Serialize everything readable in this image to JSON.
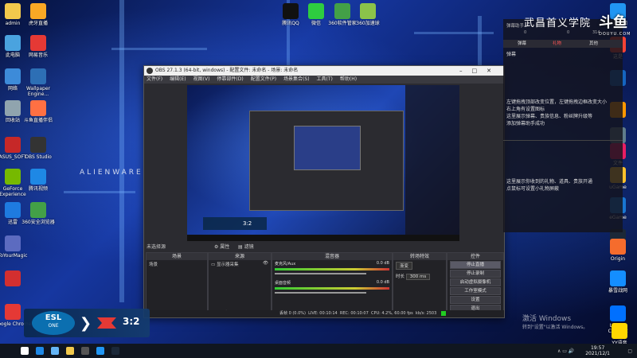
{
  "desktop": {
    "left_icons": [
      {
        "label": "admin",
        "color": "#f2c94c"
      },
      {
        "label": "虎牙直播",
        "color": "#f9a825"
      },
      {
        "label": "此电脑",
        "color": "#4aa3df"
      },
      {
        "label": "网易音乐",
        "color": "#e53935"
      },
      {
        "label": "网络",
        "color": "#3d8bd9"
      },
      {
        "label": "Wallpaper Engine...",
        "color": "#2d6fb5"
      },
      {
        "label": "回收站",
        "color": "#90a4ae"
      },
      {
        "label": "斗鱼直播伴侣",
        "color": "#ff7043"
      },
      {
        "label": "ASUS_SOFT",
        "color": "#c62828"
      },
      {
        "label": "OBS Studio",
        "color": "#333333"
      },
      {
        "label": "GeForce Experience",
        "color": "#76b900"
      },
      {
        "label": "腾讯视频",
        "color": "#1e88e5"
      },
      {
        "label": "迅雷",
        "color": "#1e7be0"
      },
      {
        "label": "360安全浏览器",
        "color": "#43a047"
      },
      {
        "label": "ToYourMagic",
        "color": "#5c6bc0"
      },
      {
        "label": "",
        "color": "#d32f2f"
      },
      {
        "label": "Google Chrome",
        "color": "#e53935"
      }
    ],
    "top_icons": [
      {
        "label": "腾讯QQ",
        "color": "#111111"
      },
      {
        "label": "微信",
        "color": "#2ecc40"
      },
      {
        "label": "360软件管家",
        "color": "#43a047"
      },
      {
        "label": "360加速球",
        "color": "#8bc34a"
      }
    ],
    "right_icons": [
      {
        "label": "这是桌面",
        "color": "#2196f3"
      },
      {
        "label": "这是",
        "color": "#f44336"
      },
      {
        "label": "",
        "color": "#1565c0"
      },
      {
        "label": "",
        "color": "#ff9800"
      },
      {
        "label": "",
        "color": "#607d8b"
      },
      {
        "label": "文件",
        "color": "#e91e63"
      },
      {
        "label": "uGame",
        "color": "#fbc02d"
      },
      {
        "label": "eGame",
        "color": "#1976d2"
      },
      {
        "label": "Steam",
        "color": "#1b2838"
      },
      {
        "label": "Origin",
        "color": "#f56c2d"
      },
      {
        "label": "暴雪战网",
        "color": "#148eff"
      },
      {
        "label": "Ubisoft Connect",
        "color": "#0070ff"
      },
      {
        "label": "YY语音",
        "color": "#ffd600"
      }
    ]
  },
  "brand_text": "ALIENWARE",
  "obs": {
    "title": "OBS 27.1.3 (64-bit, windows) - 配置文件: 未命名 - 场景: 未命名",
    "menu": [
      "文件(F)",
      "编辑(E)",
      "视图(V)",
      "停靠部件(D)",
      "配置文件(P)",
      "场景集合(S)",
      "工具(T)",
      "帮助(H)"
    ],
    "no_source_label": "未选择源",
    "props_button": "属性",
    "filters_button": "滤镜",
    "panels": {
      "scenes": {
        "title": "场景",
        "items": [
          "场景"
        ]
      },
      "sources": {
        "title": "来源",
        "items": [
          "显示器采集"
        ]
      },
      "mixer": {
        "title": "混音器",
        "channels": [
          {
            "name": "麦克风/Aux",
            "db": "0.0 dB"
          },
          {
            "name": "桌面音频",
            "db": "0.0 dB"
          }
        ]
      },
      "transitions": {
        "title": "转场特效",
        "type": "渐变",
        "duration_label": "时长",
        "duration": "300 ms"
      },
      "controls": {
        "title": "控件",
        "buttons": [
          "停止直播",
          "停止录制",
          "启动虚拟摄像机",
          "工作室模式",
          "设置",
          "退出"
        ]
      }
    },
    "status": {
      "dropped": "丢帧 0 (0.0%)",
      "live": "LIVE: 00:10:14",
      "rec": "REC: 00:10:07",
      "cpu": "CPU: 4.2%, 60.00 fps",
      "kbps": "kb/s: 2503"
    }
  },
  "danmu": {
    "room_label": "弹幕助手",
    "channel_title": "武昌首义学院",
    "stats": [
      "0",
      "0",
      "314"
    ],
    "tabs": [
      "弹幕",
      "礼物",
      "其他"
    ],
    "active_tab": 1,
    "section1": "弹幕",
    "hint1": "左键拖拽顶部改变位置，左键拖拽边框改变大小\n右上角有设置图标\n这里展示弹幕、贵族信息、粉丝牌升级等\n添加弹幕助手成功",
    "hint2": "这里展示你收到的礼物、道具、贵族开通\n点鼠标可设置小礼物屏蔽",
    "logo": "斗鱼",
    "logo_sub": "DOUYU.COM"
  },
  "stream_overlay": {
    "league": "ESL",
    "league_sub": "ONE",
    "score": "3:2"
  },
  "activation": {
    "title": "激活 Windows",
    "subtitle": "转到\"设置\"以激活 Windows。"
  },
  "taskbar": {
    "time": "19:57",
    "date": "2021/12/1",
    "colors": [
      "#ffffff",
      "#1e88e5",
      "#64b5f6",
      "#f2c94c",
      "#555555",
      "#2196f3",
      "#1b2838"
    ]
  }
}
